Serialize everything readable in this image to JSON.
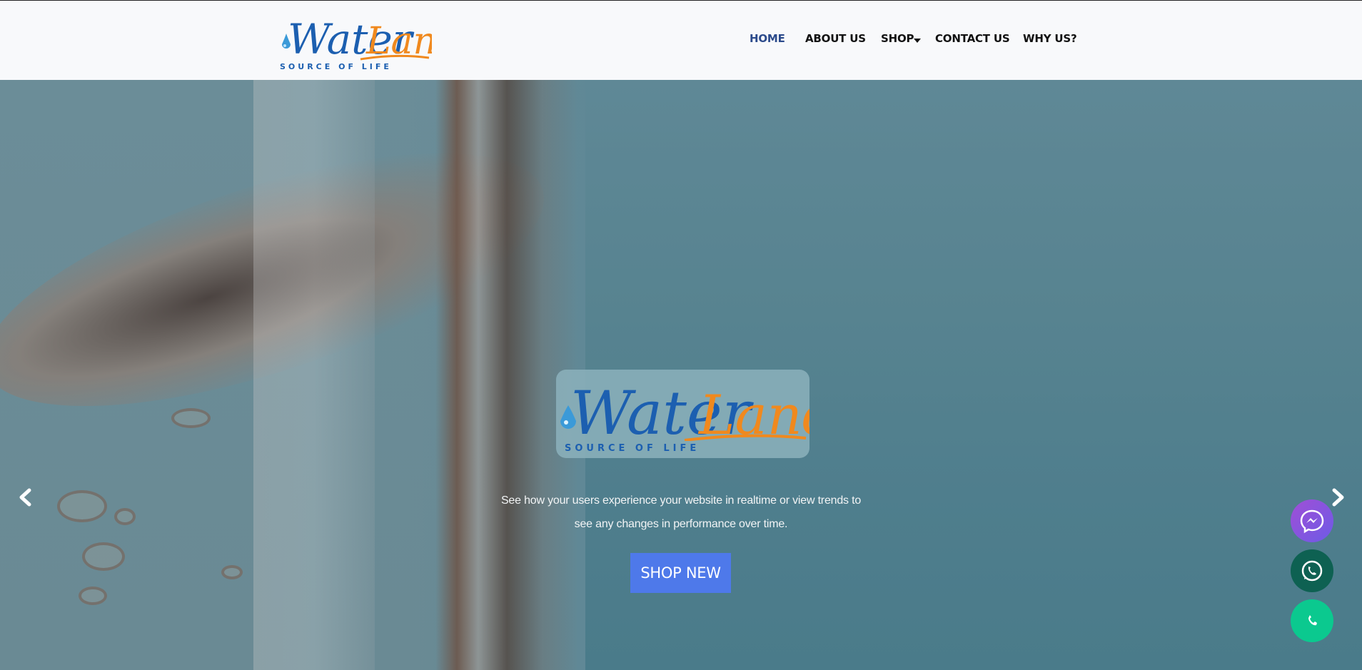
{
  "brand": {
    "name_part1": "Water",
    "name_part2": "Land",
    "tagline": "SOURCE OF LIFE"
  },
  "nav": {
    "items": [
      {
        "label": "HOME",
        "active": true
      },
      {
        "label": "ABOUT US",
        "active": false
      },
      {
        "label": "SHOP",
        "active": false,
        "has_dropdown": true
      },
      {
        "label": "CONTACT US",
        "active": false
      },
      {
        "label": "WHY US?",
        "active": false
      }
    ]
  },
  "hero": {
    "text": "See how your users experience your website in realtime or view trends to see any changes in performance over time.",
    "button_label": "SHOP NEW",
    "prev_icon": "chevron-left-icon",
    "next_icon": "chevron-right-icon"
  },
  "floating_actions": [
    {
      "name": "messenger-button",
      "icon": "messenger-icon",
      "color": "#8e55e0"
    },
    {
      "name": "whatsapp-button",
      "icon": "whatsapp-icon",
      "color": "#0e6152"
    },
    {
      "name": "phone-button",
      "icon": "phone-icon",
      "color": "#0bc98f"
    }
  ],
  "colors": {
    "nav_active": "#2b4a8b",
    "brand_blue": "#1c5fb0",
    "brand_orange": "#f0891e",
    "button": "#4e79ea"
  }
}
